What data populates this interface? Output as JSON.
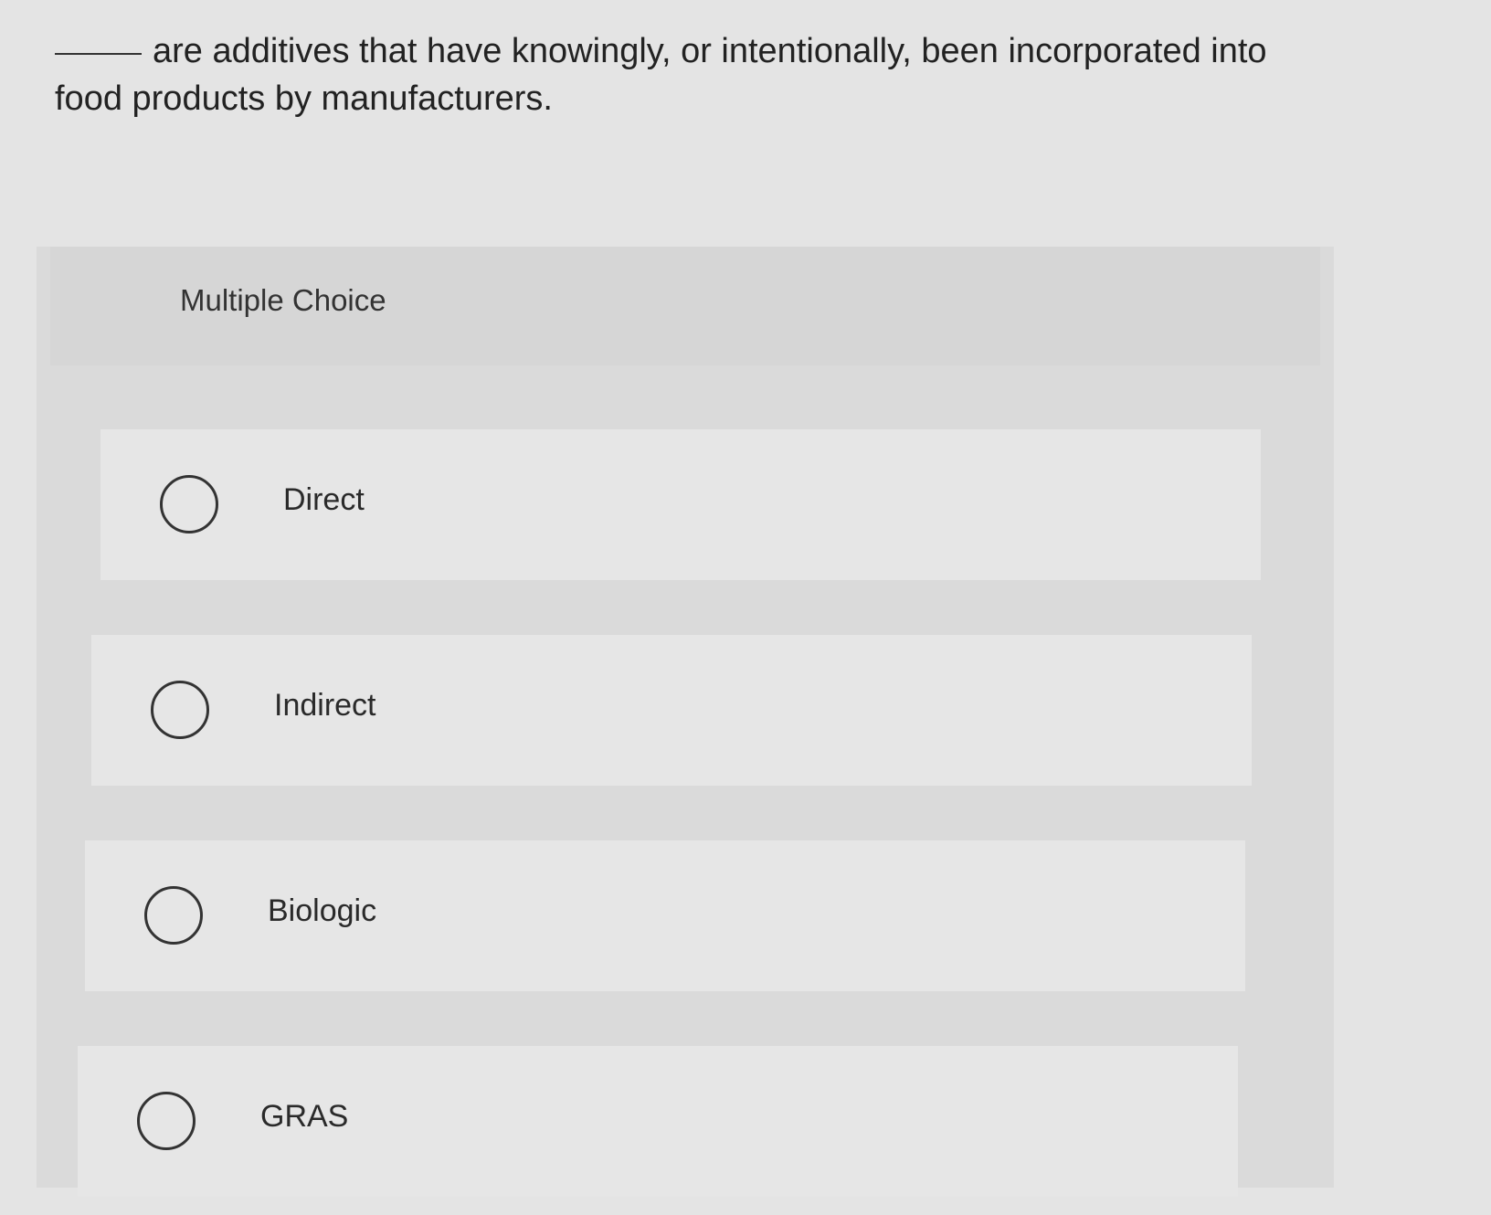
{
  "question": {
    "text": "are additives that have knowingly, or intentionally, been incorporated into food products by manufacturers."
  },
  "multiple_choice": {
    "title": "Multiple Choice",
    "options": [
      {
        "label": "Direct"
      },
      {
        "label": "Indirect"
      },
      {
        "label": "Biologic"
      },
      {
        "label": "GRAS"
      }
    ]
  }
}
